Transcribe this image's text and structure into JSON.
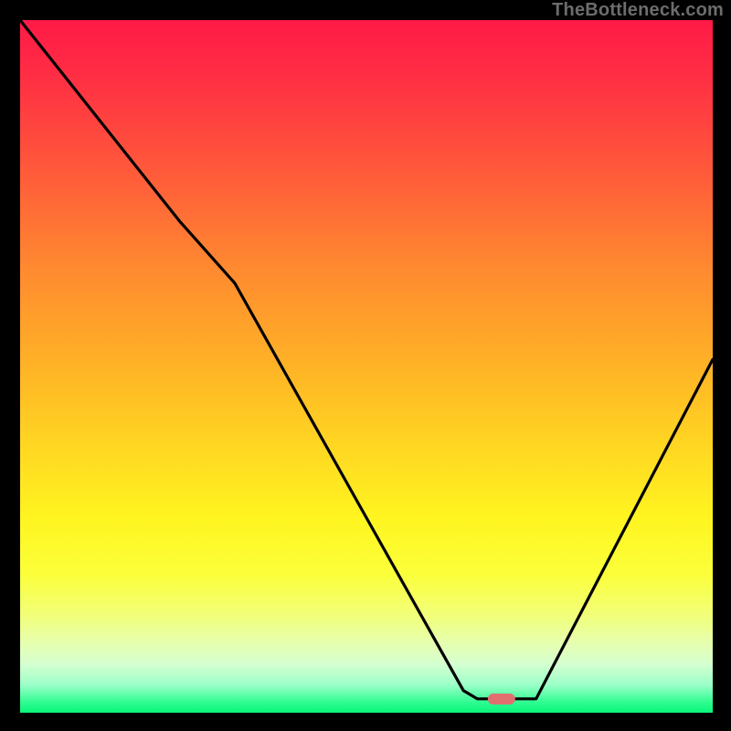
{
  "watermark": "TheBottleneck.com",
  "chart_data": {
    "type": "line",
    "title": "",
    "xlabel": "",
    "ylabel": "",
    "xlim": [
      0,
      1
    ],
    "ylim": [
      0,
      1
    ],
    "x": [
      0.0,
      0.23,
      0.31,
      0.64,
      0.66,
      0.745,
      1.0
    ],
    "values": [
      1.0,
      0.71,
      0.62,
      0.032,
      0.02,
      0.02,
      0.51
    ],
    "marker": {
      "x": 0.695,
      "y": 0.02,
      "width_frac": 0.04
    },
    "background_gradient_stops": [
      {
        "pos": 0.0,
        "color": "#ff1a47"
      },
      {
        "pos": 0.08,
        "color": "#ff2e44"
      },
      {
        "pos": 0.22,
        "color": "#ff5a3a"
      },
      {
        "pos": 0.36,
        "color": "#ff8a30"
      },
      {
        "pos": 0.5,
        "color": "#ffb326"
      },
      {
        "pos": 0.62,
        "color": "#ffd822"
      },
      {
        "pos": 0.72,
        "color": "#fff520"
      },
      {
        "pos": 0.8,
        "color": "#fbff3a"
      },
      {
        "pos": 0.86,
        "color": "#f1ff7a"
      },
      {
        "pos": 0.9,
        "color": "#e6ffb0"
      },
      {
        "pos": 0.93,
        "color": "#d5ffd0"
      },
      {
        "pos": 0.96,
        "color": "#9bffc8"
      },
      {
        "pos": 0.986,
        "color": "#2bfc8f"
      },
      {
        "pos": 1.0,
        "color": "#0af57a"
      }
    ]
  }
}
